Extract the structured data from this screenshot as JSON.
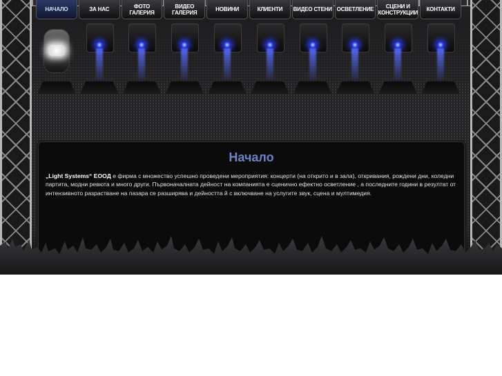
{
  "nav": {
    "items": [
      {
        "label": "НАЧАЛО"
      },
      {
        "label": "ЗА НАС"
      },
      {
        "label": "ФОТО ГАЛЕРИЯ"
      },
      {
        "label": "ВИДЕО ГАЛЕРИЯ"
      },
      {
        "label": "НОВИНИ"
      },
      {
        "label": "КЛИЕНТИ"
      },
      {
        "label": "ВИДЕО СТЕНИ"
      },
      {
        "label": "ОСВЕТЛЕНИЕ"
      },
      {
        "label": "СЦЕНИ И КОНСТРУКЦИИ"
      },
      {
        "label": "КОНТАКТИ"
      }
    ],
    "active_index": 0
  },
  "content": {
    "title": "Начало",
    "company": "„Light Systems“ ЕООД",
    "text": " е фирма с множество успешно проведени мероприятия: концерти (на открито и в зала), откривания, рождени дни, коледни партита, модни ревюта и много други. Първоначалната дейност на компанията е сценично ефектно осветление , а последните години в резултат от интензивното разрастване на пазара се разширява и дейността й с включване на услугите звук, сцена и мултимедия."
  },
  "colors": {
    "title": "#6d82c7",
    "light_beam": "#3f55ff",
    "nav_active": "#2c3a66"
  },
  "icons": {
    "stage_light": "moving-head-light-icon",
    "crowd": "crowd-silhouette"
  }
}
